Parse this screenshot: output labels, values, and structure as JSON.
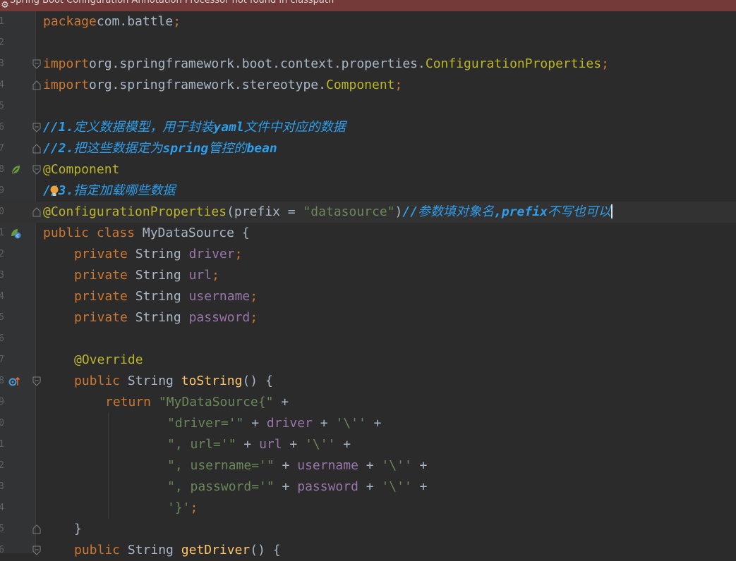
{
  "banner": {
    "icon": "warning-icon",
    "text": "Spring Boot Configuration Annotation Processor not found in classpath"
  },
  "colors": {
    "background": "#2b2b2b",
    "gutter": "#313335",
    "keyword": "#cc7832",
    "annotation": "#bbb529",
    "string": "#6a8759",
    "field": "#9876aa",
    "method": "#ffc66d",
    "comment": "#2f9eea",
    "text": "#a9b7c6"
  },
  "lines": [
    {
      "n": "1",
      "tokens": [
        [
          "kw",
          "package"
        ],
        [
          "",
          "com.battle"
        ],
        [
          "sem",
          ";"
        ]
      ]
    },
    {
      "n": "2",
      "tokens": []
    },
    {
      "n": "3",
      "tokens": [
        [
          "kw",
          "import"
        ],
        [
          "",
          "org.springframework.boot.context.properties."
        ],
        [
          "ann",
          "ConfigurationProperties"
        ],
        [
          "sem",
          ";"
        ]
      ]
    },
    {
      "n": "4",
      "tokens": [
        [
          "kw",
          "import"
        ],
        [
          "",
          "org.springframework.stereotype."
        ],
        [
          "ann",
          "Component"
        ],
        [
          "sem",
          ";"
        ]
      ]
    },
    {
      "n": "5",
      "tokens": []
    },
    {
      "n": "6",
      "tokens": [
        [
          "cmt",
          "//1.定义数据模型，用于封装yaml文件中对应的数据"
        ]
      ]
    },
    {
      "n": "7",
      "tokens": [
        [
          "cmt",
          "//2.把这些数据定为spring管控的bean"
        ]
      ]
    },
    {
      "n": "8",
      "tokens": [
        [
          "ann",
          "@Component"
        ]
      ]
    },
    {
      "n": "9",
      "tokens": [
        [
          "cmt",
          "//3.指定加载哪些数据"
        ]
      ]
    },
    {
      "n": "0",
      "tokens": [
        [
          "ann",
          "@ConfigurationProperties"
        ],
        [
          "",
          "(prefix = "
        ],
        [
          "str",
          "\"datasource\""
        ],
        [
          "",
          ")"
        ],
        [
          "cmt",
          "//参数填对象名,prefix不写也可以"
        ]
      ]
    },
    {
      "n": "1",
      "tokens": [
        [
          "kw",
          "public class"
        ],
        [
          "",
          " MyDataSource {"
        ]
      ]
    },
    {
      "n": "2",
      "tokens": [
        [
          "kw",
          "private"
        ],
        [
          "",
          " String "
        ],
        [
          "fld",
          "driver"
        ],
        [
          "sem",
          ";"
        ]
      ]
    },
    {
      "n": "3",
      "tokens": [
        [
          "kw",
          "private"
        ],
        [
          "",
          " String "
        ],
        [
          "fld",
          "url"
        ],
        [
          "sem",
          ";"
        ]
      ]
    },
    {
      "n": "4",
      "tokens": [
        [
          "kw",
          "private"
        ],
        [
          "",
          " String "
        ],
        [
          "fld",
          "username"
        ],
        [
          "sem",
          ";"
        ]
      ]
    },
    {
      "n": "5",
      "tokens": [
        [
          "kw",
          "private"
        ],
        [
          "",
          " String "
        ],
        [
          "fld",
          "password"
        ],
        [
          "sem",
          ";"
        ]
      ]
    },
    {
      "n": "6",
      "tokens": []
    },
    {
      "n": "7",
      "tokens": [
        [
          "ann",
          "@Override"
        ]
      ]
    },
    {
      "n": "8",
      "tokens": [
        [
          "kw",
          "public"
        ],
        [
          "",
          " String "
        ],
        [
          "mth",
          "toString"
        ],
        [
          "",
          "() {"
        ]
      ]
    },
    {
      "n": "9",
      "tokens": [
        [
          "kw",
          "return "
        ],
        [
          "str",
          "\"MyDataSource{\""
        ],
        [
          "",
          " +"
        ]
      ]
    },
    {
      "n": "0",
      "tokens": [
        [
          "str",
          "\"driver='\""
        ],
        [
          "",
          " + "
        ],
        [
          "fld",
          "driver"
        ],
        [
          "",
          " + "
        ],
        [
          "str",
          "'\\''"
        ],
        [
          "",
          " +"
        ]
      ]
    },
    {
      "n": "1",
      "tokens": [
        [
          "str",
          "\", url='\""
        ],
        [
          "",
          " + "
        ],
        [
          "fld",
          "url"
        ],
        [
          "",
          " + "
        ],
        [
          "str",
          "'\\''"
        ],
        [
          "",
          " +"
        ]
      ]
    },
    {
      "n": "2",
      "tokens": [
        [
          "str",
          "\", username='\""
        ],
        [
          "",
          " + "
        ],
        [
          "fld",
          "username"
        ],
        [
          "",
          " + "
        ],
        [
          "str",
          "'\\''"
        ],
        [
          "",
          " +"
        ]
      ]
    },
    {
      "n": "3",
      "tokens": [
        [
          "str",
          "\", password='\""
        ],
        [
          "",
          " + "
        ],
        [
          "fld",
          "password"
        ],
        [
          "",
          " + "
        ],
        [
          "str",
          "'\\''"
        ],
        [
          "",
          " +"
        ]
      ]
    },
    {
      "n": "4",
      "tokens": [
        [
          "str",
          "'}'"
        ],
        [
          "sem",
          ";"
        ]
      ]
    },
    {
      "n": "5",
      "tokens": [
        [
          "",
          "}"
        ]
      ]
    },
    {
      "n": "6",
      "tokens": [
        [
          "kw",
          "public"
        ],
        [
          "",
          " String "
        ],
        [
          "mth",
          "getDriver"
        ],
        [
          "",
          "() {"
        ]
      ]
    }
  ]
}
